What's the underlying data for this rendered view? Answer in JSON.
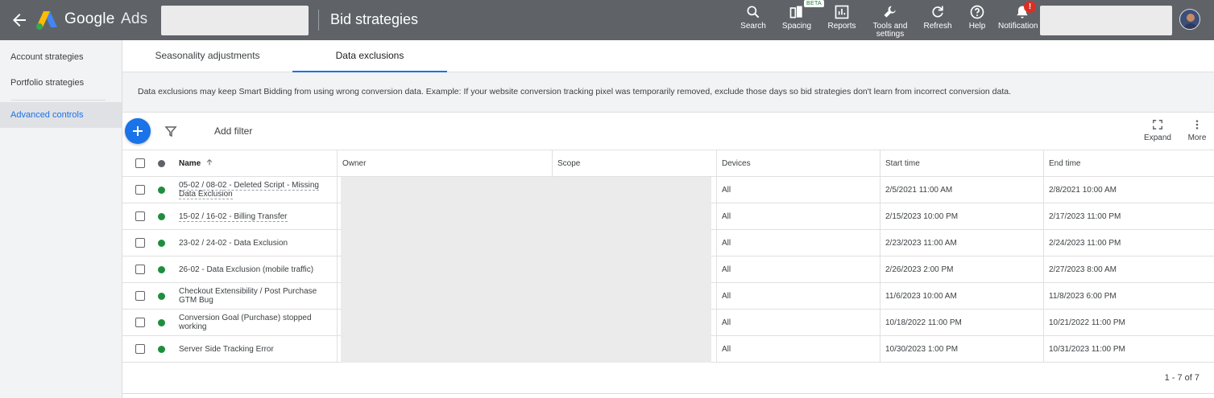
{
  "header": {
    "brand_google": "Google",
    "brand_ads": "Ads",
    "page_title": "Bid strategies",
    "tools": [
      {
        "label": "Search",
        "icon": "search-icon"
      },
      {
        "label": "Spacing",
        "icon": "spacing-icon"
      },
      {
        "label": "Reports",
        "icon": "reports-icon"
      },
      {
        "label": "Tools and",
        "label2": "settings",
        "icon": "wrench-icon"
      },
      {
        "label": "Refresh",
        "icon": "refresh-icon"
      },
      {
        "label": "Help",
        "icon": "help-icon"
      },
      {
        "label": "Notification",
        "icon": "bell-icon"
      }
    ],
    "beta_badge": "BETA",
    "notification_badge": "!"
  },
  "sidebar": {
    "items": [
      {
        "label": "Account strategies"
      },
      {
        "label": "Portfolio strategies"
      },
      {
        "label": "Advanced controls"
      }
    ]
  },
  "tabs": [
    {
      "label": "Seasonality adjustments"
    },
    {
      "label": "Data exclusions"
    }
  ],
  "info_text": "Data exclusions may keep Smart Bidding from using wrong conversion data. Example: If your website conversion tracking pixel was temporarily removed, exclude those days so bid strategies don't learn from incorrect conversion data.",
  "toolbar": {
    "add_filter": "Add filter",
    "expand": "Expand",
    "more": "More"
  },
  "table": {
    "columns": {
      "name": "Name",
      "owner": "Owner",
      "scope": "Scope",
      "devices": "Devices",
      "start": "Start time",
      "end": "End time"
    },
    "rows": [
      {
        "name": "05-02 / 08-02 - Deleted Script - Missing Data Exclusion",
        "devices": "All",
        "start": "2/5/2021 11:00 AM",
        "end": "2/8/2021 10:00 AM"
      },
      {
        "name": "15-02 / 16-02 - Billing Transfer",
        "devices": "All",
        "start": "2/15/2023 10:00 PM",
        "end": "2/17/2023 11:00 PM"
      },
      {
        "name": "23-02 / 24-02 - Data Exclusion",
        "devices": "All",
        "start": "2/23/2023 11:00 AM",
        "end": "2/24/2023 11:00 PM"
      },
      {
        "name": "26-02 - Data Exclusion (mobile traffic)",
        "devices": "All",
        "start": "2/26/2023 2:00 PM",
        "end": "2/27/2023 8:00 AM"
      },
      {
        "name": "Checkout Extensibility / Post Purchase GTM Bug",
        "devices": "All",
        "start": "11/6/2023 10:00 AM",
        "end": "11/8/2023 6:00 PM"
      },
      {
        "name": "Conversion Goal (Purchase) stopped working",
        "devices": "All",
        "start": "10/18/2022 11:00 PM",
        "end": "10/21/2022 11:00 PM"
      },
      {
        "name": "Server Side Tracking Error",
        "devices": "All",
        "start": "10/30/2023 1:00 PM",
        "end": "10/31/2023 11:00 PM"
      }
    ],
    "pagination": "1 - 7 of 7"
  },
  "colors": {
    "topbar": "#5f6368",
    "accent": "#1a73e8",
    "status_enabled": "#1e8e3e"
  }
}
